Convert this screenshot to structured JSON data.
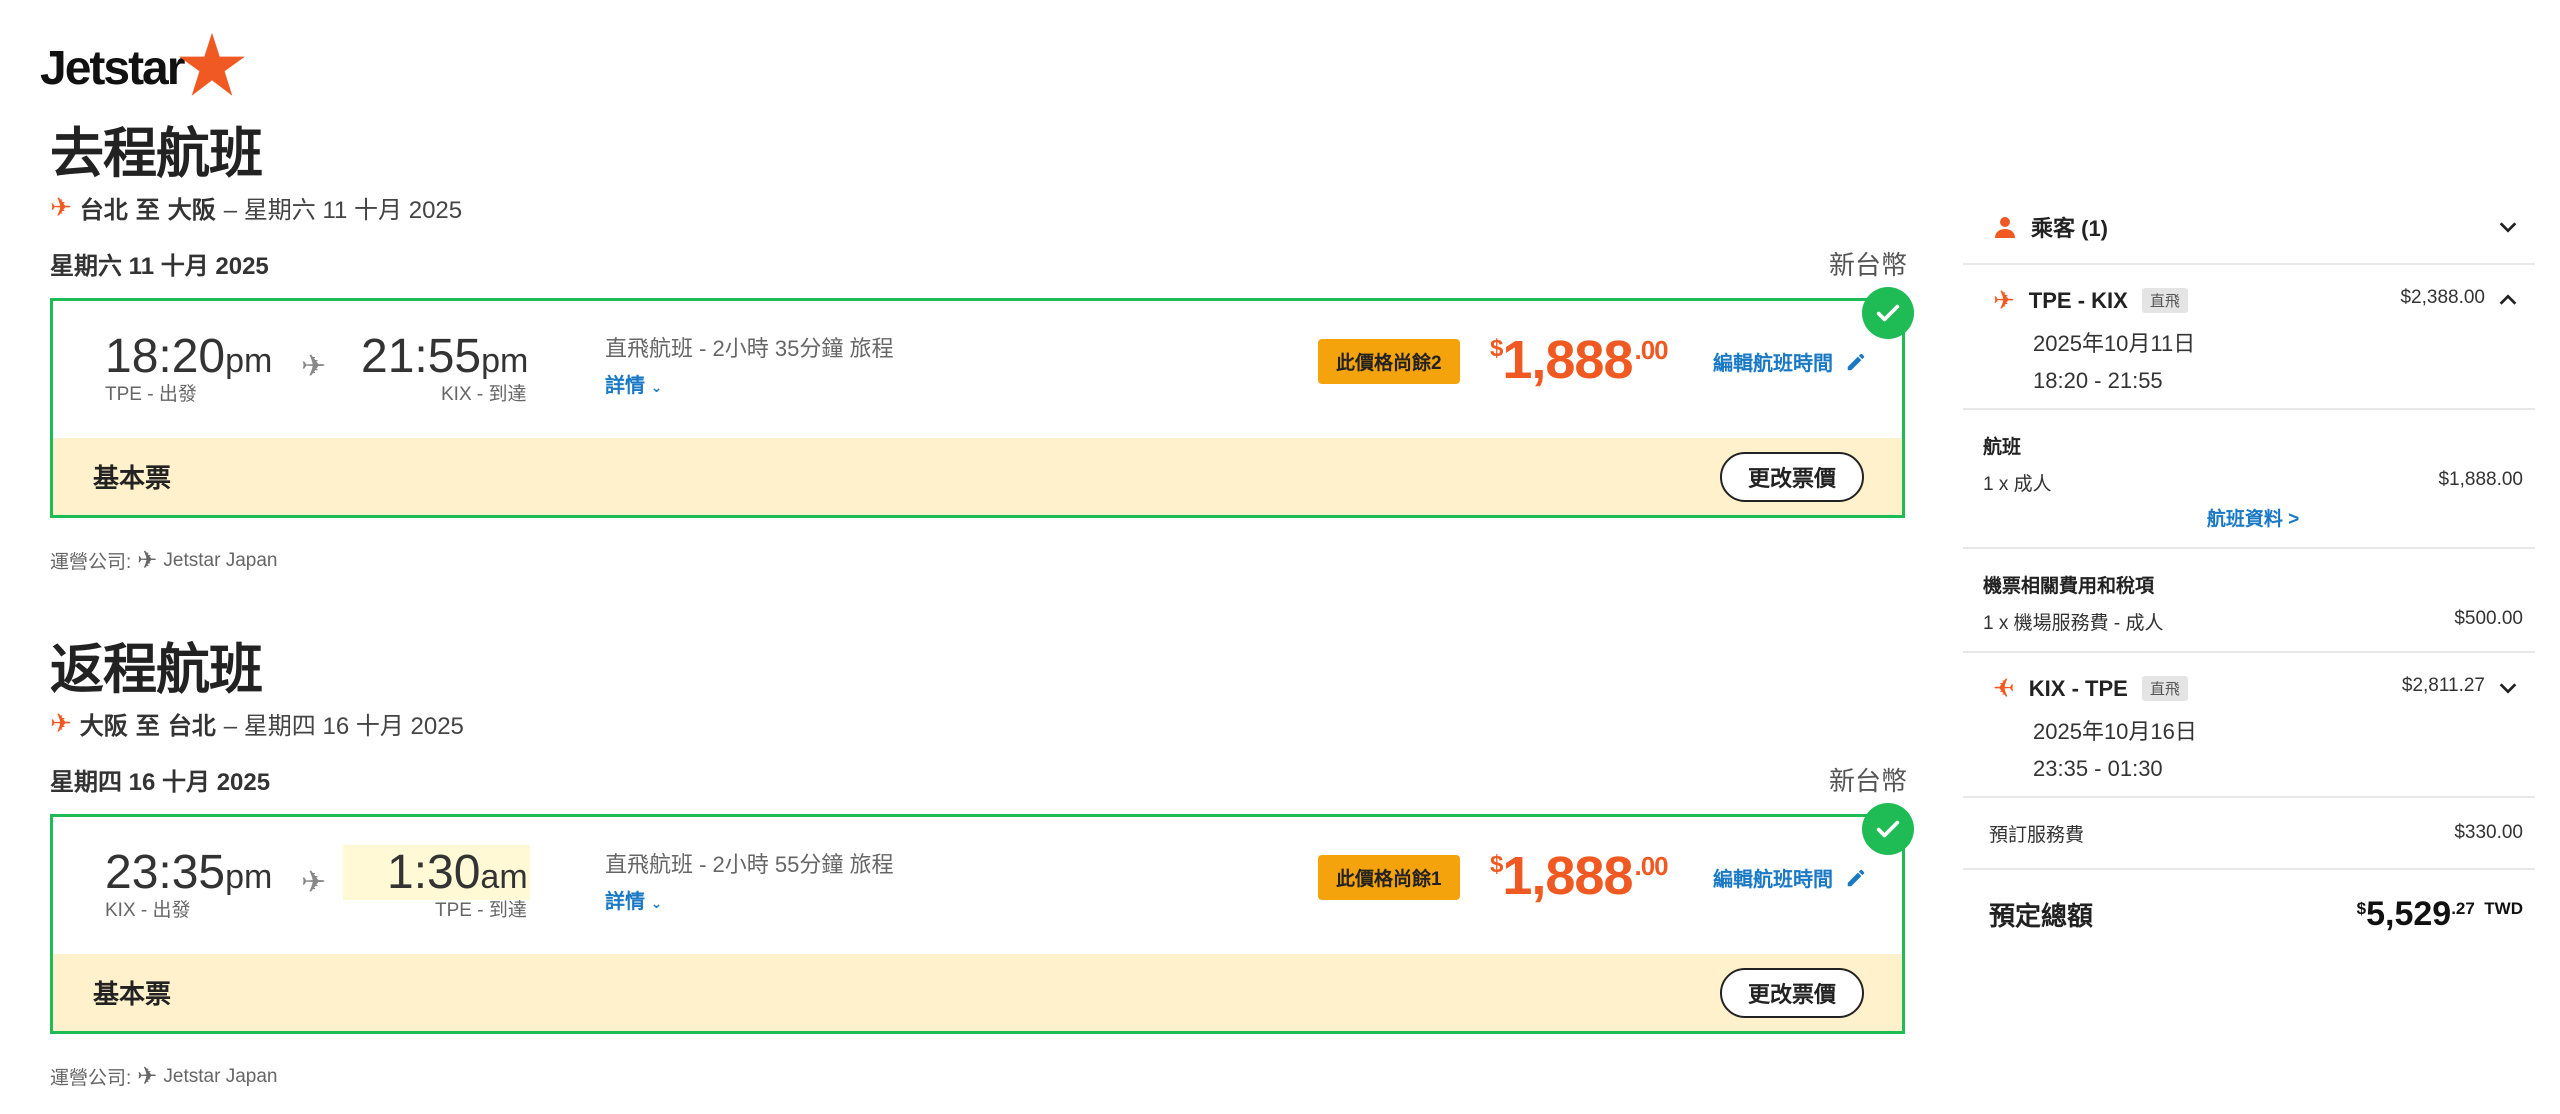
{
  "brand": {
    "name": "Jetstar",
    "color": "#f05a22"
  },
  "colors": {
    "accent": "#f05a22",
    "selected": "#1fbb55",
    "link": "#1a79c4",
    "badge": "#f5a30c",
    "fare_bg": "#fff1cc"
  },
  "outbound": {
    "title": "去程航班",
    "route_from": "台北",
    "route_to_word": "至",
    "route_to": "大阪",
    "route_date": "– 星期六 11 十月 2025",
    "date": "星期六 11 十月 2025",
    "currency": "新台幣",
    "dep_time": "18:20",
    "dep_ampm": "pm",
    "dep_label": "TPE - 出發",
    "arr_time": "21:55",
    "arr_ampm": "pm",
    "arr_label": "KIX - 到達",
    "duration": "直飛航班 - 2小時 35分鐘 旅程",
    "details": "詳情",
    "badge": "此價格尚餘2",
    "price_symbol": "$",
    "price_main": "1,888",
    "price_cents": ".00",
    "edit": "編輯航班時間",
    "fare_name": "基本票",
    "change": "更改票價",
    "operator_label": "運營公司:",
    "operator": "Jetstar Japan"
  },
  "return": {
    "title": "返程航班",
    "route_from": "大阪",
    "route_to_word": "至",
    "route_to": "台北",
    "route_date": "– 星期四 16 十月 2025",
    "date": "星期四 16 十月 2025",
    "currency": "新台幣",
    "dep_time": "23:35",
    "dep_ampm": "pm",
    "dep_label": "KIX - 出發",
    "arr_time": "1:30",
    "arr_ampm": "am",
    "arr_label": "TPE - 到達",
    "duration": "直飛航班 - 2小時 55分鐘 旅程",
    "details": "詳情",
    "badge": "此價格尚餘1",
    "price_symbol": "$",
    "price_main": "1,888",
    "price_cents": ".00",
    "edit": "編輯航班時間",
    "fare_name": "基本票",
    "change": "更改票價",
    "operator_label": "運營公司:",
    "operator": "Jetstar Japan"
  },
  "summary": {
    "passengers": "乘客 (1)",
    "leg1": {
      "code": "TPE - KIX",
      "tag": "直飛",
      "price": "$2,388.00",
      "date": "2025年10月11日",
      "time": "18:20 - 21:55"
    },
    "flight_section": {
      "head": "航班",
      "item": "1 x 成人",
      "amount": "$1,888.00",
      "link": "航班資料 >"
    },
    "tax_section": {
      "head": "機票相關費用和稅項",
      "item": "1 x 機場服務費 - 成人",
      "amount": "$500.00"
    },
    "leg2": {
      "code": "KIX - TPE",
      "tag": "直飛",
      "price": "$2,811.27",
      "date": "2025年10月16日",
      "time": "23:35 - 01:30"
    },
    "booking_fee": {
      "label": "預訂服務費",
      "amount": "$330.00"
    },
    "total": {
      "label": "預定總額",
      "symbol": "$",
      "main": "5,529",
      "cents": ".27",
      "currency": "TWD"
    }
  }
}
